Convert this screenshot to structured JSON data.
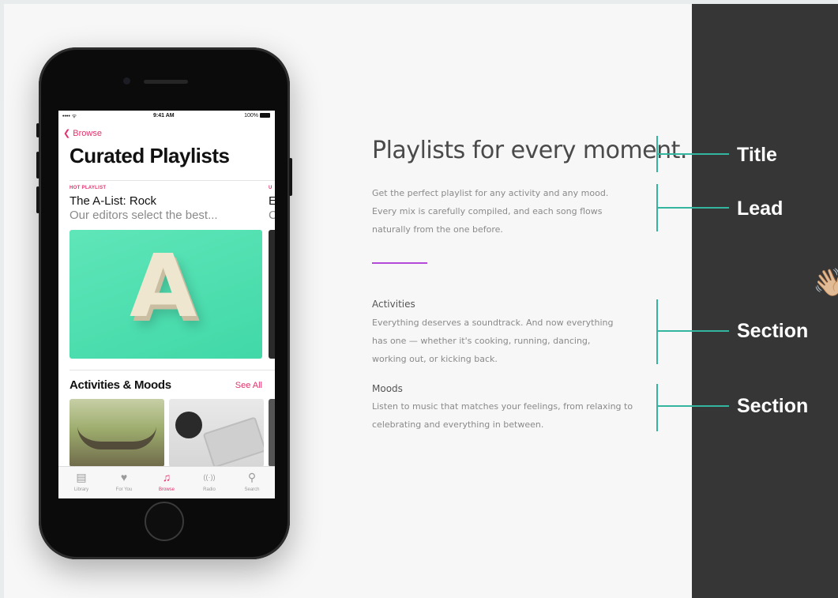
{
  "phone": {
    "status": {
      "signal": "•••• ᯤ",
      "time": "9:41 AM",
      "battery": "100%"
    },
    "back_label": "Browse",
    "title": "Curated Playlists",
    "featured": [
      {
        "tag": "HOT PLAYLIST",
        "title": "The A-List: Rock",
        "subtitle": "Our editors select the best..."
      },
      {
        "tag": "U",
        "title": "E",
        "subtitle": "C"
      }
    ],
    "hero_letter": "A",
    "section_title": "Activities & Moods",
    "see_all": "See All",
    "tabs": [
      {
        "icon": "library-icon",
        "glyph": "▤",
        "label": "Library"
      },
      {
        "icon": "heart-icon",
        "glyph": "♥",
        "label": "For You"
      },
      {
        "icon": "music-note-icon",
        "glyph": "♫",
        "label": "Browse"
      },
      {
        "icon": "radio-icon",
        "glyph": "((·))",
        "label": "Radio"
      },
      {
        "icon": "search-icon",
        "glyph": "⚲",
        "label": "Search"
      }
    ],
    "active_tab": "Browse",
    "accent": "#e2336b"
  },
  "copy": {
    "title": "Playlists for every moment.",
    "lead": [
      "Get the perfect playlist for any activity and any mood.",
      "Every mix is carefully compiled, and each song flows",
      "naturally from the one before."
    ],
    "sections": [
      {
        "heading": "Activities",
        "body": [
          "Everything deserves a soundtrack. And now everything",
          "has one — whether it's cooking, running, dancing,",
          "working out, or kicking back."
        ]
      },
      {
        "heading": "Moods",
        "body": [
          "Listen to music that matches your feelings, from relaxing to",
          "celebrating and everything in between."
        ]
      }
    ],
    "accent_line_color": "#b44ad9"
  },
  "annotations": {
    "labels": [
      "Title",
      "Lead",
      "Section",
      "Section"
    ],
    "bracket_color": "#33b5a0",
    "hand_emoji": "👋🏼"
  }
}
